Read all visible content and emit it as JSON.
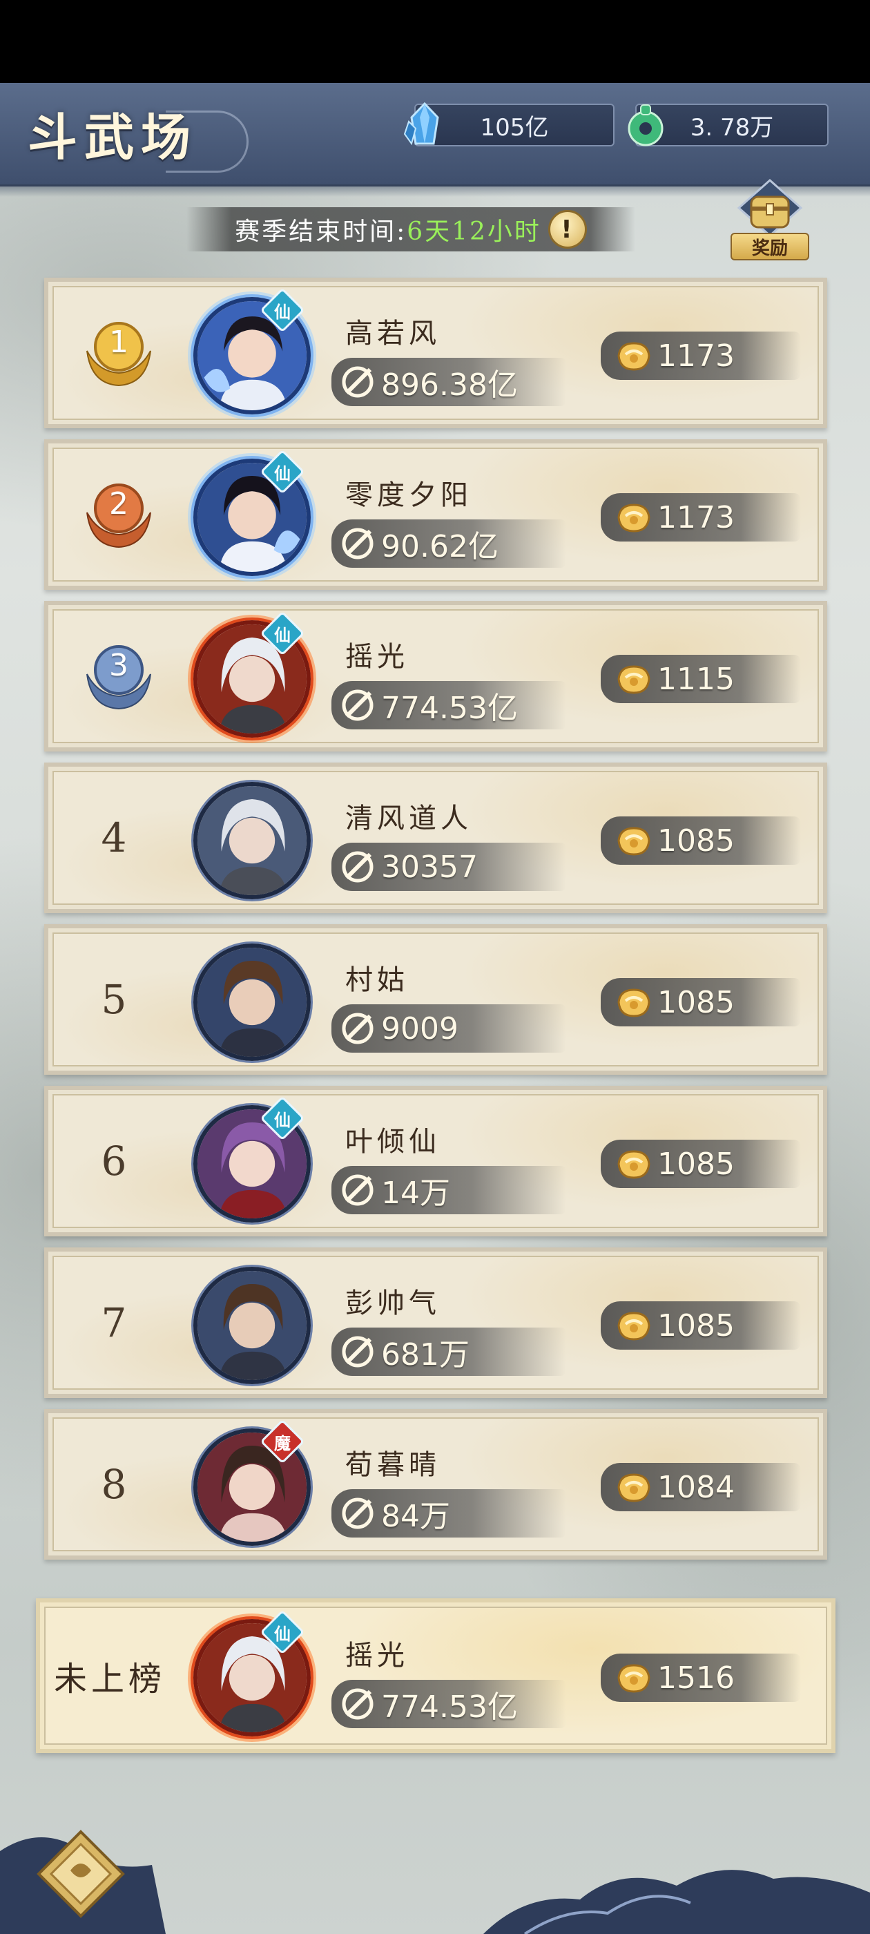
{
  "header": {
    "title": "斗武场",
    "currency_gem": "105亿",
    "currency_jade": "3. 78万"
  },
  "season": {
    "label": "赛季结束时间:",
    "remaining": "6天12小时",
    "info_symbol": "!"
  },
  "reward_button": {
    "label": "奖励"
  },
  "rankings": [
    {
      "rank": "1",
      "medal": "gold",
      "name": "高若风",
      "badge": "仙",
      "frame": "blue",
      "power": "896.38亿",
      "score": "1173"
    },
    {
      "rank": "2",
      "medal": "bronze",
      "name": "零度夕阳",
      "badge": "仙",
      "frame": "blue",
      "power": "90.62亿",
      "score": "1173"
    },
    {
      "rank": "3",
      "medal": "silver",
      "name": "摇光",
      "badge": "仙",
      "frame": "red",
      "power": "774.53亿",
      "score": "1115"
    },
    {
      "rank": "4",
      "medal": "",
      "name": "清风道人",
      "badge": "",
      "frame": "plain",
      "power": "30357",
      "score": "1085"
    },
    {
      "rank": "5",
      "medal": "",
      "name": "村姑",
      "badge": "",
      "frame": "plain",
      "power": "9009",
      "score": "1085"
    },
    {
      "rank": "6",
      "medal": "",
      "name": "叶倾仙",
      "badge": "仙",
      "frame": "plain",
      "power": "14万",
      "score": "1085"
    },
    {
      "rank": "7",
      "medal": "",
      "name": "彭帅气",
      "badge": "",
      "frame": "plain",
      "power": "681万",
      "score": "1085"
    },
    {
      "rank": "8",
      "medal": "",
      "name": "荀暮晴",
      "badge": "魔",
      "frame": "plain",
      "power": "84万",
      "score": "1084"
    }
  ],
  "self": {
    "rank_label": "未上榜",
    "name": "摇光",
    "badge": "仙",
    "power": "774.53亿",
    "score": "1516"
  },
  "colors": {
    "header_bg": "#4a5a7a",
    "row_bg": "#efe8d6",
    "season_highlight": "#9af05a",
    "badge_immortal": "#2aa5c7",
    "badge_demon": "#c8302a"
  },
  "icons": {
    "gem": "blue-crystal-icon",
    "jade": "jade-coin-icon",
    "power": "sword-power-icon",
    "score": "gold-ingot-score-icon",
    "reward": "treasure-chest-icon",
    "corner": "menu-diamond-icon"
  }
}
